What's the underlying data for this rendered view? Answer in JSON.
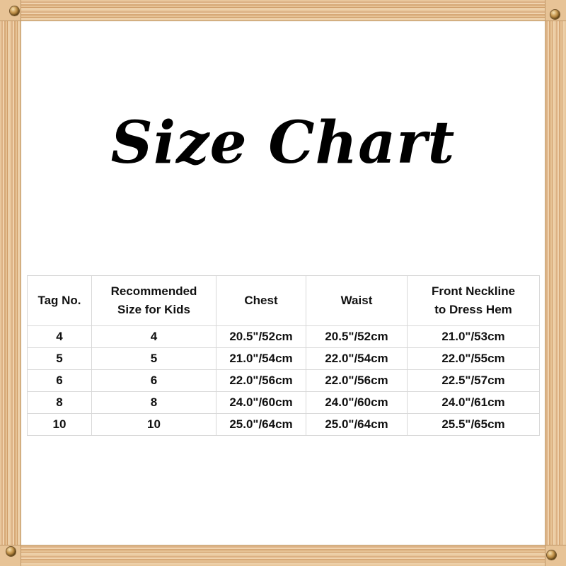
{
  "frame": {
    "material": "wood",
    "wood_color": "#e3bd8d",
    "screw_color": "#8a6326",
    "screws": [
      "screw-top-left",
      "screw-top-right",
      "screw-bottom-left",
      "screw-bottom-right"
    ]
  },
  "title": "Size Chart",
  "table": {
    "headers": [
      {
        "line1": "Tag No.",
        "line2": ""
      },
      {
        "line1": "Recommended",
        "line2": "Size for Kids"
      },
      {
        "line1": "Chest",
        "line2": ""
      },
      {
        "line1": "Waist",
        "line2": ""
      },
      {
        "line1": "Front Neckline",
        "line2": "to Dress Hem"
      }
    ],
    "rows": [
      {
        "tag_no": "4",
        "recommended_size": "4",
        "chest": "20.5\"/52cm",
        "waist": "20.5\"/52cm",
        "front_neckline_to_dress_hem": "21.0\"/53cm"
      },
      {
        "tag_no": "5",
        "recommended_size": "5",
        "chest": "21.0\"/54cm",
        "waist": "22.0\"/54cm",
        "front_neckline_to_dress_hem": "22.0\"/55cm"
      },
      {
        "tag_no": "6",
        "recommended_size": "6",
        "chest": "22.0\"/56cm",
        "waist": "22.0\"/56cm",
        "front_neckline_to_dress_hem": "22.5\"/57cm"
      },
      {
        "tag_no": "8",
        "recommended_size": "8",
        "chest": "24.0\"/60cm",
        "waist": "24.0\"/60cm",
        "front_neckline_to_dress_hem": "24.0\"/61cm"
      },
      {
        "tag_no": "10",
        "recommended_size": "10",
        "chest": "25.0\"/64cm",
        "waist": "25.0\"/64cm",
        "front_neckline_to_dress_hem": "25.5\"/65cm"
      }
    ]
  }
}
